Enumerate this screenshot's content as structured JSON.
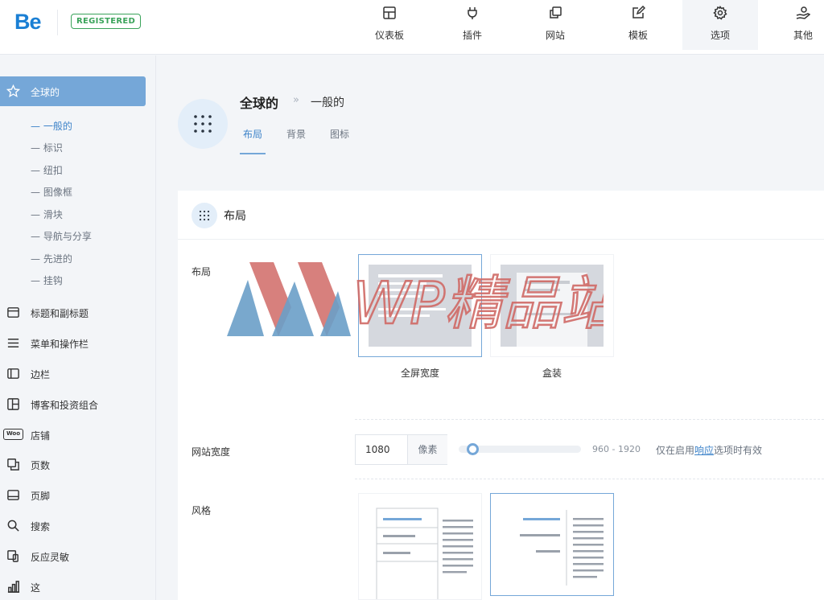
{
  "header": {
    "logo": "Be",
    "badge": "REGISTERED",
    "nav": [
      {
        "label": "仪表板",
        "icon": "dashboard-icon"
      },
      {
        "label": "插件",
        "icon": "plug-icon"
      },
      {
        "label": "网站",
        "icon": "websites-icon"
      },
      {
        "label": "模板",
        "icon": "template-icon"
      },
      {
        "label": "选项",
        "icon": "gear-icon",
        "active": true
      },
      {
        "label": "其他",
        "icon": "user-hand-icon"
      }
    ]
  },
  "sidebar": {
    "active": {
      "label": "全球的",
      "icon": "star-icon"
    },
    "subitems": [
      "一般的",
      "标识",
      "纽扣",
      "图像框",
      "滑块",
      "导航与分享",
      "先进的",
      "挂钩"
    ],
    "items": [
      {
        "label": "标题和副标题",
        "icon": "header-icon"
      },
      {
        "label": "菜单和操作栏",
        "icon": "menu-icon"
      },
      {
        "label": "边栏",
        "icon": "sidebar-icon"
      },
      {
        "label": "博客和投资组合",
        "icon": "grid-icon"
      },
      {
        "label": "店铺",
        "icon": "woo-icon",
        "woo_text": "Woo"
      },
      {
        "label": "页数",
        "icon": "pages-icon"
      },
      {
        "label": "页脚",
        "icon": "footer-icon"
      },
      {
        "label": "搜索",
        "icon": "search-icon"
      },
      {
        "label": "反应灵敏",
        "icon": "responsive-icon"
      },
      {
        "label": "这",
        "icon": "chart-icon"
      }
    ]
  },
  "page": {
    "breadcrumb_main": "全球的",
    "breadcrumb_sep": "»",
    "breadcrumb_sub": "一般的",
    "tabs": [
      "布局",
      "背景",
      "图标"
    ]
  },
  "card": {
    "title": "布局",
    "layout": {
      "label": "布局",
      "options": [
        {
          "label": "全屏宽度",
          "selected": true
        },
        {
          "label": "盒装",
          "selected": false
        }
      ]
    },
    "site_width": {
      "label": "网站宽度",
      "value": "1080",
      "unit": "像素",
      "range": "960 - 1920",
      "hint_before": "仅在启用",
      "hint_link": "响应",
      "hint_after": "选项时有效"
    },
    "style": {
      "label": "风格"
    }
  },
  "watermark": {
    "text": "WP精品站"
  },
  "colors": {
    "accent": "#75a7d8",
    "link": "#3d83c9",
    "badge": "#3aa35a"
  }
}
